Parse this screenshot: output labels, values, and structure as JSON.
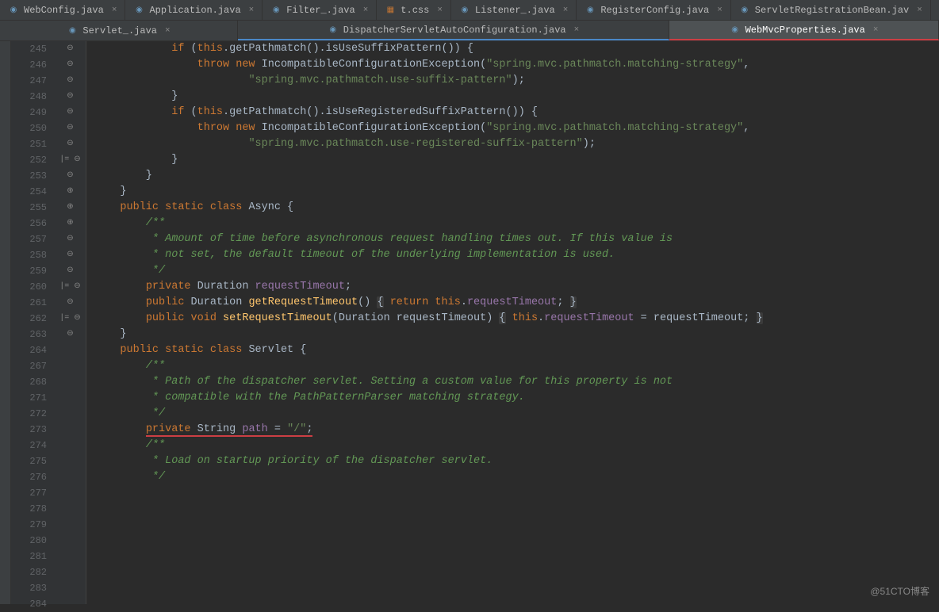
{
  "tabs_row1": [
    {
      "label": "WebConfig.java",
      "icon": "java"
    },
    {
      "label": "Application.java",
      "icon": "java"
    },
    {
      "label": "Filter_.java",
      "icon": "java"
    },
    {
      "label": "t.css",
      "icon": "css"
    },
    {
      "label": "Listener_.java",
      "icon": "java"
    },
    {
      "label": "RegisterConfig.java",
      "icon": "java"
    },
    {
      "label": "ServletRegistrationBean.jav",
      "icon": "java"
    }
  ],
  "tabs_row2": [
    {
      "label": "Servlet_.java",
      "icon": "java",
      "style": ""
    },
    {
      "label": "DispatcherServletAutoConfiguration.java",
      "icon": "java",
      "style": "blue"
    },
    {
      "label": "WebMvcProperties.java",
      "icon": "java",
      "style": "red",
      "active": true
    }
  ],
  "line_numbers": [
    "245",
    "246",
    "247",
    "248",
    "249",
    "250",
    "251",
    "252",
    "253",
    "254",
    "255",
    "256",
    "257",
    "258",
    "259",
    "260",
    "261",
    "262",
    "263",
    "264",
    "267",
    "268",
    "271",
    "272",
    "273",
    "274",
    "275",
    "276",
    "277",
    "278",
    "279",
    "280",
    "281",
    "282",
    "283",
    "284"
  ],
  "fold_marks": [
    "⊖",
    "",
    "",
    "⊖",
    "⊖",
    "",
    "",
    "⊖",
    "⊖",
    "⊖",
    "",
    "⊖",
    "",
    "|= ⊖",
    "",
    "",
    "",
    "⊖",
    "",
    "⊕",
    "⊕",
    "⊕",
    "⊖",
    "⊖",
    "",
    "⊖",
    "",
    "|= ⊖",
    "",
    "",
    "⊖",
    "",
    "",
    "|= ⊖",
    "",
    "⊖"
  ],
  "code_lines": [
    {
      "t": "pre",
      "c": "            <span class='kw'>if</span> (<span class='this'>this</span>.getPathmatch().isUseSuffixPattern()) {"
    },
    {
      "t": "pre",
      "c": "                <span class='kw'>throw new</span> IncompatibleConfigurationException(<span class='str'>\"spring.mvc.pathmatch.matching-strategy\"</span>,"
    },
    {
      "t": "pre",
      "c": "                        <span class='str'>\"spring.mvc.pathmatch.use-suffix-pattern\"</span>);"
    },
    {
      "t": "pre",
      "c": "            }"
    },
    {
      "t": "pre",
      "c": "            <span class='kw'>if</span> (<span class='this'>this</span>.getPathmatch().isUseRegisteredSuffixPattern()) {"
    },
    {
      "t": "pre",
      "c": "                <span class='kw'>throw new</span> IncompatibleConfigurationException(<span class='str'>\"spring.mvc.pathmatch.matching-strategy\"</span>,"
    },
    {
      "t": "pre",
      "c": "                        <span class='str'>\"spring.mvc.pathmatch.use-registered-suffix-pattern\"</span>);"
    },
    {
      "t": "pre",
      "c": "            }"
    },
    {
      "t": "pre",
      "c": "        }"
    },
    {
      "t": "pre",
      "c": "    }"
    },
    {
      "t": "pre",
      "c": ""
    },
    {
      "t": "pre",
      "c": "    <span class='kw'>public static class</span> Async {"
    },
    {
      "t": "pre",
      "c": ""
    },
    {
      "t": "pre",
      "c": "        <span class='com-mark'>/**</span>"
    },
    {
      "t": "pre",
      "c": "<span class='com'>         * Amount of time before asynchronous request handling times out. If this value is</span>"
    },
    {
      "t": "pre",
      "c": "<span class='com'>         * not set, the default timeout of the underlying implementation is used.</span>"
    },
    {
      "t": "pre",
      "c": "<span class='com'>         */</span>"
    },
    {
      "t": "pre",
      "c": "        <span class='kw'>private</span> Duration <span class='field'>requestTimeout</span>;"
    },
    {
      "t": "pre",
      "c": ""
    },
    {
      "t": "pre",
      "c": "        <span class='kw'>public</span> Duration <span class='method'>getRequestTimeout</span>() <span class='fold-bg'>{</span> <span class='kw'>return</span> <span class='this'>this</span>.<span class='field'>requestTimeout</span>; <span class='fold-bg'>}</span>"
    },
    {
      "t": "pre",
      "c": "        <span class='kw'>public void</span> <span class='method'>setRequestTimeout</span>(Duration requestTimeout) <span class='fold-bg'>{</span> <span class='this'>this</span>.<span class='field'>requestTimeout</span> = requestTimeout; <span class='fold-bg'>}</span>"
    },
    {
      "t": "pre",
      "c": ""
    },
    {
      "t": "pre",
      "c": "    }"
    },
    {
      "t": "pre",
      "c": ""
    },
    {
      "t": "pre",
      "c": "    <span class='kw'>public static class</span> Servlet {"
    },
    {
      "t": "pre",
      "c": ""
    },
    {
      "t": "pre",
      "c": "        <span class='com-mark'>/**</span>"
    },
    {
      "t": "pre",
      "c": "<span class='com'>         * Path of the dispatcher servlet. Setting a custom value for this property is not</span>"
    },
    {
      "t": "pre",
      "c": "<span class='com'>         * compatible with the PathPatternParser matching strategy.</span>"
    },
    {
      "t": "pre",
      "c": "<span class='com'>         */</span>"
    },
    {
      "t": "pre",
      "c": "        <span class='underline-red'><span class='kw'>private</span> String <span class='field'>path</span> = <span class='str'>\"/\"</span>;</span>"
    },
    {
      "t": "pre",
      "c": ""
    },
    {
      "t": "pre",
      "c": "        <span class='com-mark'>/**</span>"
    },
    {
      "t": "pre",
      "c": "<span class='com'>         * Load on startup priority of the dispatcher servlet.</span>"
    },
    {
      "t": "pre",
      "c": "<span class='com'>         */</span>"
    },
    {
      "t": "pre",
      "c": ""
    }
  ],
  "watermark": "@51CTO博客"
}
